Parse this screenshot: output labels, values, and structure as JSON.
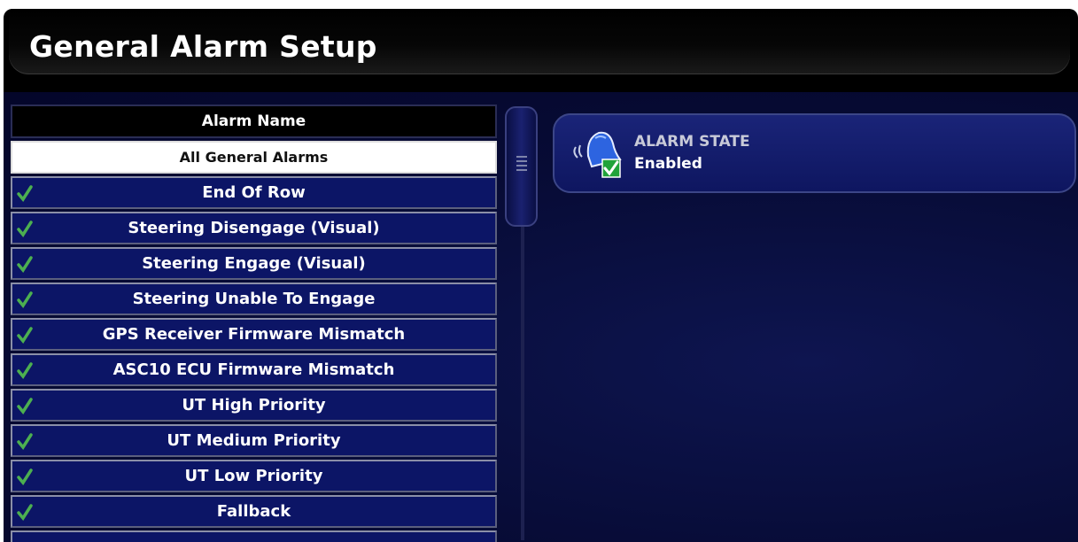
{
  "header": {
    "title": "General Alarm Setup"
  },
  "alarm_list": {
    "column_header": "Alarm Name",
    "selected_item": "All General Alarms",
    "items": [
      {
        "label": "End Of Row",
        "enabled": true
      },
      {
        "label": "Steering Disengage (Visual)",
        "enabled": true
      },
      {
        "label": "Steering Engage (Visual)",
        "enabled": true
      },
      {
        "label": "Steering Unable To Engage",
        "enabled": true
      },
      {
        "label": "GPS Receiver Firmware Mismatch",
        "enabled": true
      },
      {
        "label": "ASC10 ECU Firmware Mismatch",
        "enabled": true
      },
      {
        "label": "UT High Priority",
        "enabled": true
      },
      {
        "label": "UT Medium Priority",
        "enabled": true
      },
      {
        "label": "UT Low Priority",
        "enabled": true
      },
      {
        "label": "Fallback",
        "enabled": true
      }
    ]
  },
  "alarm_state": {
    "label": "ALARM STATE",
    "value": "Enabled"
  },
  "colors": {
    "row_bg": "#0c1566",
    "check": "#4caf50",
    "accent": "#1a2478"
  },
  "icons": {
    "row": "check-icon",
    "state": "bell-icon"
  }
}
